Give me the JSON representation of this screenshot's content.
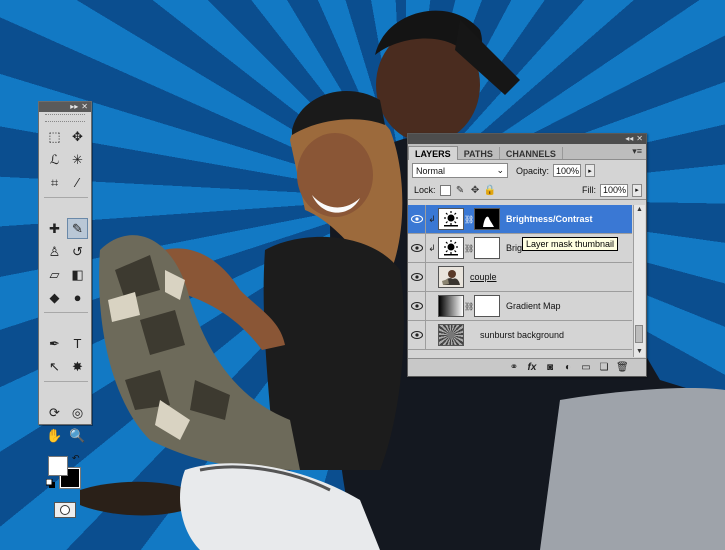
{
  "tools_panel": {
    "collapse_glyph": "▸▸",
    "close_glyph": "✕",
    "tools": [
      {
        "name": "marquee-tool-icon",
        "glyph": "⬚"
      },
      {
        "name": "move-tool-icon",
        "glyph": "✥"
      },
      {
        "name": "lasso-tool-icon",
        "glyph": "ℒ"
      },
      {
        "name": "magic-wand-tool-icon",
        "glyph": "✳"
      },
      {
        "name": "crop-tool-icon",
        "glyph": "⌗"
      },
      {
        "name": "eyedropper-tool-icon",
        "glyph": "⁄"
      },
      {
        "name": "healing-brush-tool-icon",
        "glyph": "✚"
      },
      {
        "name": "brush-tool-icon",
        "glyph": "✎",
        "active": true
      },
      {
        "name": "clone-stamp-tool-icon",
        "glyph": "♙"
      },
      {
        "name": "history-brush-tool-icon",
        "glyph": "↺"
      },
      {
        "name": "eraser-tool-icon",
        "glyph": "▱"
      },
      {
        "name": "paint-bucket-tool-icon",
        "glyph": "◧"
      },
      {
        "name": "blur-tool-icon",
        "glyph": "◆"
      },
      {
        "name": "dodge-tool-icon",
        "glyph": "●"
      },
      {
        "name": "pen-tool-icon",
        "glyph": "✒"
      },
      {
        "name": "type-tool-icon",
        "glyph": "T"
      },
      {
        "name": "path-selection-tool-icon",
        "glyph": "↖"
      },
      {
        "name": "custom-shape-tool-icon",
        "glyph": "✸"
      },
      {
        "name": "3d-rotate-tool-icon",
        "glyph": "⟳"
      },
      {
        "name": "3d-orbit-tool-icon",
        "glyph": "◎"
      },
      {
        "name": "hand-tool-icon",
        "glyph": "✋"
      },
      {
        "name": "zoom-tool-icon",
        "glyph": "🔍"
      }
    ],
    "colors": {
      "foreground": "#ffffff",
      "background": "#000000"
    }
  },
  "layers_panel": {
    "tabs": [
      {
        "label": "LAYERS",
        "active": true
      },
      {
        "label": "PATHS",
        "active": false
      },
      {
        "label": "CHANNELS",
        "active": false
      }
    ],
    "panel_menu_glyph": "▾≡",
    "blend_mode": "Normal",
    "opacity_label": "Opacity:",
    "opacity_value": "100%",
    "lock_label": "Lock:",
    "fill_label": "Fill:",
    "fill_value": "100%",
    "tooltip": "Layer mask thumbnail",
    "layers": [
      {
        "name": "Brightness/Contrast",
        "type": "adjustment",
        "selected": true,
        "clipped": true
      },
      {
        "name": "Brightness/Contrast",
        "type": "adjustment",
        "selected": false,
        "clipped": true
      },
      {
        "name": "couple",
        "type": "photo",
        "selected": false,
        "clipped": false
      },
      {
        "name": "Gradient Map",
        "type": "gradient",
        "selected": false,
        "clipped": false
      },
      {
        "name": "sunburst background",
        "type": "sunburst",
        "selected": false,
        "clipped": false
      }
    ],
    "footer_buttons": [
      "link-layers-icon",
      "fx-icon",
      "add-mask-icon",
      "adjustment-layer-icon",
      "group-icon",
      "new-layer-icon",
      "trash-icon"
    ],
    "footer_glyphs": [
      "⚭",
      "fx",
      "◙",
      "◐",
      "▭",
      "❏",
      "🗑"
    ]
  },
  "colors": {
    "sunburst_light": "#1279c4",
    "sunburst_dark": "#0b4e8f",
    "selection_blue": "#3a78d4",
    "panel_gray": "#d4d4d4"
  }
}
